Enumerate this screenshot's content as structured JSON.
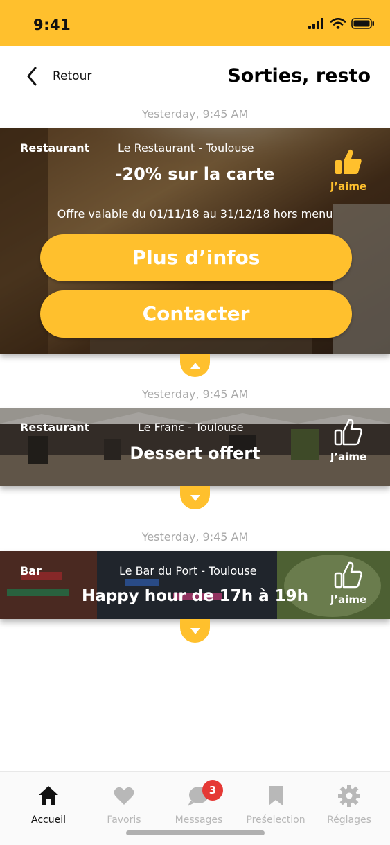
{
  "status_bar": {
    "time": "9:41"
  },
  "header": {
    "back_label": "Retour",
    "title": "Sorties, resto"
  },
  "colors": {
    "accent": "#FFC02D",
    "badge": "#E53935",
    "muted": "#a9a9a9"
  },
  "offers": [
    {
      "timestamp": "Yesterday, 9:45 AM",
      "category": "Restaurant",
      "venue": "Le Restaurant - Toulouse",
      "offer": "-20% sur la carte",
      "validity": "Offre valable du 01/11/18 au 31/12/18 hors menu",
      "like_label": "J’aime",
      "liked": true,
      "more_info_label": "Plus d’infos",
      "contact_label": "Contacter",
      "expanded": true
    },
    {
      "timestamp": "Yesterday, 9:45 AM",
      "category": "Restaurant",
      "venue": "Le Franc - Toulouse",
      "offer": "Dessert offert",
      "like_label": "J’aime",
      "liked": false,
      "expanded": false
    },
    {
      "timestamp": "Yesterday, 9:45 AM",
      "category": "Bar",
      "venue": "Le Bar du Port - Toulouse",
      "offer": "Happy hour de 17h à 19h",
      "like_label": "J’aime",
      "liked": false,
      "expanded": false
    }
  ],
  "tab_bar": {
    "active": "Accueil",
    "tabs": [
      {
        "label": "Accueil",
        "icon": "home-icon"
      },
      {
        "label": "Favoris",
        "icon": "heart-icon"
      },
      {
        "label": "Messages",
        "icon": "message-icon",
        "badge": "3"
      },
      {
        "label": "Preśelection",
        "icon": "bookmark-icon"
      },
      {
        "label": "Réglages",
        "icon": "gear-icon"
      }
    ]
  }
}
